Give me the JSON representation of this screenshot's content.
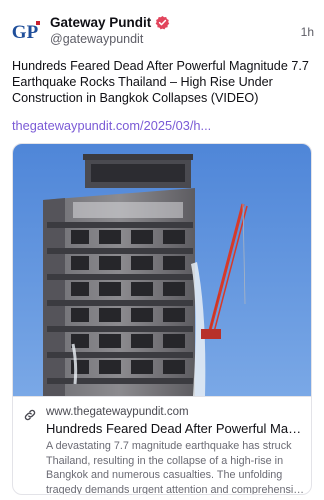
{
  "post": {
    "author": {
      "display_name": "Gateway Pundit",
      "handle": "@gatewaypundit",
      "avatar_text": "GP",
      "verified_icon": "verified-badge-icon"
    },
    "timestamp": "1h",
    "text": "Hundreds Feared Dead After Powerful Magnitude 7.7 Earthquake Rocks Thailand – High Rise Under Construction in Bangkok Collapses (VIDEO)",
    "link_text": "thegatewaypundit.com/2025/03/h...",
    "card": {
      "domain": "www.thegatewaypundit.com",
      "title": "Hundreds Feared Dead After Powerful Magnitu...",
      "description_lines": [
        "A devastating 7.7 magnitude earthquake has struck",
        "Thailand, resulting in the collapse of a high-rise in",
        "Bangkok and numerous casualties. The unfolding",
        "tragedy demands urgent attention and comprehensiv..."
      ],
      "link_icon": "link-chain-icon",
      "image": "building-under-construction-with-crane"
    }
  },
  "colors": {
    "accent_link": "#7b5bd6",
    "verified_badge": "#e2445c",
    "avatar_blue": "#1f4e9a",
    "avatar_red": "#c8202f"
  }
}
